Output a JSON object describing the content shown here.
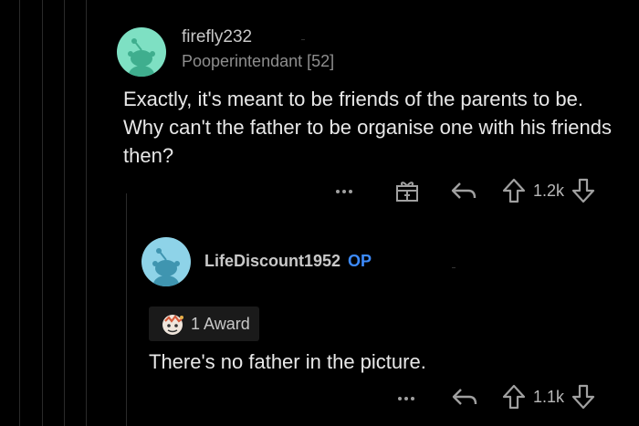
{
  "colors": {
    "background": "#000000",
    "avatar": "#7ee0c3",
    "avatar2": "#8ed3e8",
    "op": "#3d8bfd"
  },
  "comment1": {
    "username": "firefly232",
    "flair": "Pooperintendant [52]",
    "body": "Exactly, it's meant to be friends of the parents to be.  Why can't the father to be organise one with his friends then?",
    "more_icon": "more-horizontal-icon",
    "award_icon": "give-award-icon",
    "reply_icon": "reply-arrow-icon",
    "votes": "1.2k"
  },
  "comment2": {
    "username": "LifeDiscount1952",
    "op_label": "OP",
    "award_label": "1 Award",
    "body": "There's no father in the picture.",
    "votes": "1.1k"
  }
}
